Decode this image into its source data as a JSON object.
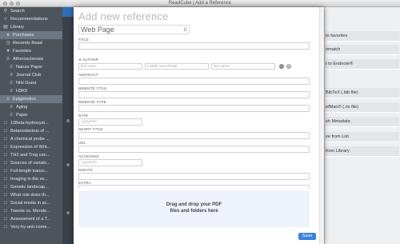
{
  "window": {
    "title": "ReadCube | Add a Reference"
  },
  "sidebar": {
    "items": [
      {
        "label": "Search",
        "icon": "search-icon",
        "indent": 0
      },
      {
        "label": "Recommendations",
        "icon": "star-icon",
        "indent": 0
      },
      {
        "label": "Library",
        "icon": "folder-icon",
        "indent": 0
      },
      {
        "label": "Purchases",
        "icon": "purchase-icon",
        "indent": 1,
        "active": true
      },
      {
        "label": "Recently Read",
        "icon": "clock-icon",
        "indent": 1
      },
      {
        "label": "Favorites",
        "icon": "heart-icon",
        "indent": 1
      },
      {
        "label": "Atherosclerosis",
        "icon": "list-icon",
        "indent": 1
      },
      {
        "label": "Nature Paper",
        "icon": "list-icon",
        "indent": 2
      },
      {
        "label": "Journal Club",
        "icon": "list-icon",
        "indent": 2
      },
      {
        "label": "NIH Grant",
        "icon": "list-icon",
        "indent": 2
      },
      {
        "label": "H3K9",
        "icon": "list-icon",
        "indent": 2
      },
      {
        "label": "Epigenetics",
        "icon": "list-icon",
        "indent": 1,
        "active": true
      },
      {
        "label": "Aging",
        "icon": "list-icon",
        "indent": 2
      },
      {
        "label": "Paper",
        "icon": "list-icon",
        "indent": 2
      },
      {
        "label": "11Beta-hydroxyst...",
        "icon": "doc-icon",
        "indent": 0
      },
      {
        "label": "Betanodavirus of ...",
        "icon": "doc-icon",
        "indent": 0
      },
      {
        "label": "A chemical probe ...",
        "icon": "doc-icon",
        "indent": 0
      },
      {
        "label": "Expression of Wnt...",
        "icon": "doc-icon",
        "indent": 0
      },
      {
        "label": "TH2 and Treg can...",
        "icon": "doc-icon",
        "indent": 0
      },
      {
        "label": "Sources of variabi...",
        "icon": "doc-icon",
        "indent": 0
      },
      {
        "label": "Full-length transc...",
        "icon": "doc-icon",
        "indent": 0
      },
      {
        "label": "Imaging in the ev...",
        "icon": "doc-icon",
        "indent": 0
      },
      {
        "label": "Genetic landscap...",
        "icon": "doc-icon",
        "indent": 0
      },
      {
        "label": "What role does th...",
        "icon": "doc-icon",
        "indent": 0
      },
      {
        "label": "Social media in ac...",
        "icon": "doc-icon",
        "indent": 0
      },
      {
        "label": "Tweets vs. Mende...",
        "icon": "doc-icon",
        "indent": 0
      },
      {
        "label": "Assessment of a T...",
        "icon": "doc-icon",
        "indent": 0
      },
      {
        "label": "Very-hy-anti-come...",
        "icon": "doc-icon",
        "indent": 0
      }
    ]
  },
  "right_panel": {
    "items": [
      "to favorites",
      "nmatch",
      "t to Endnote®",
      "BibTeX (.bib file)",
      "efMan® (.ris file)",
      "sh Metadata",
      "ve from List",
      "from Library"
    ]
  },
  "modal": {
    "title": "Add new reference",
    "type_value": "Web Page",
    "labels": {
      "title": "TITLE",
      "author": "AUTHOR",
      "abstract": "ABSTRACT",
      "website_title": "WEBSITE TITLE",
      "website_type": "WEBSITE TYPE",
      "date": "DATE",
      "short_title": "SHORT TITLE",
      "url": "URL",
      "accessed": "ACCESSED",
      "rights": "RIGHTS",
      "extra": "EXTRA"
    },
    "placeholders": {
      "first_name": "first name",
      "middle_name": "middle name/initial",
      "last_name": "last name",
      "date": "yyyy/mm",
      "accessed": "yyyy/mm"
    },
    "dropzone_line1": "Drag and drop your PDF",
    "dropzone_line2": "files and folders here",
    "save_label": "Save"
  },
  "colors": {
    "accent": "#3b82e0",
    "sidebar_bg": "#4d545c",
    "dropzone_bg": "#eef2fb"
  }
}
